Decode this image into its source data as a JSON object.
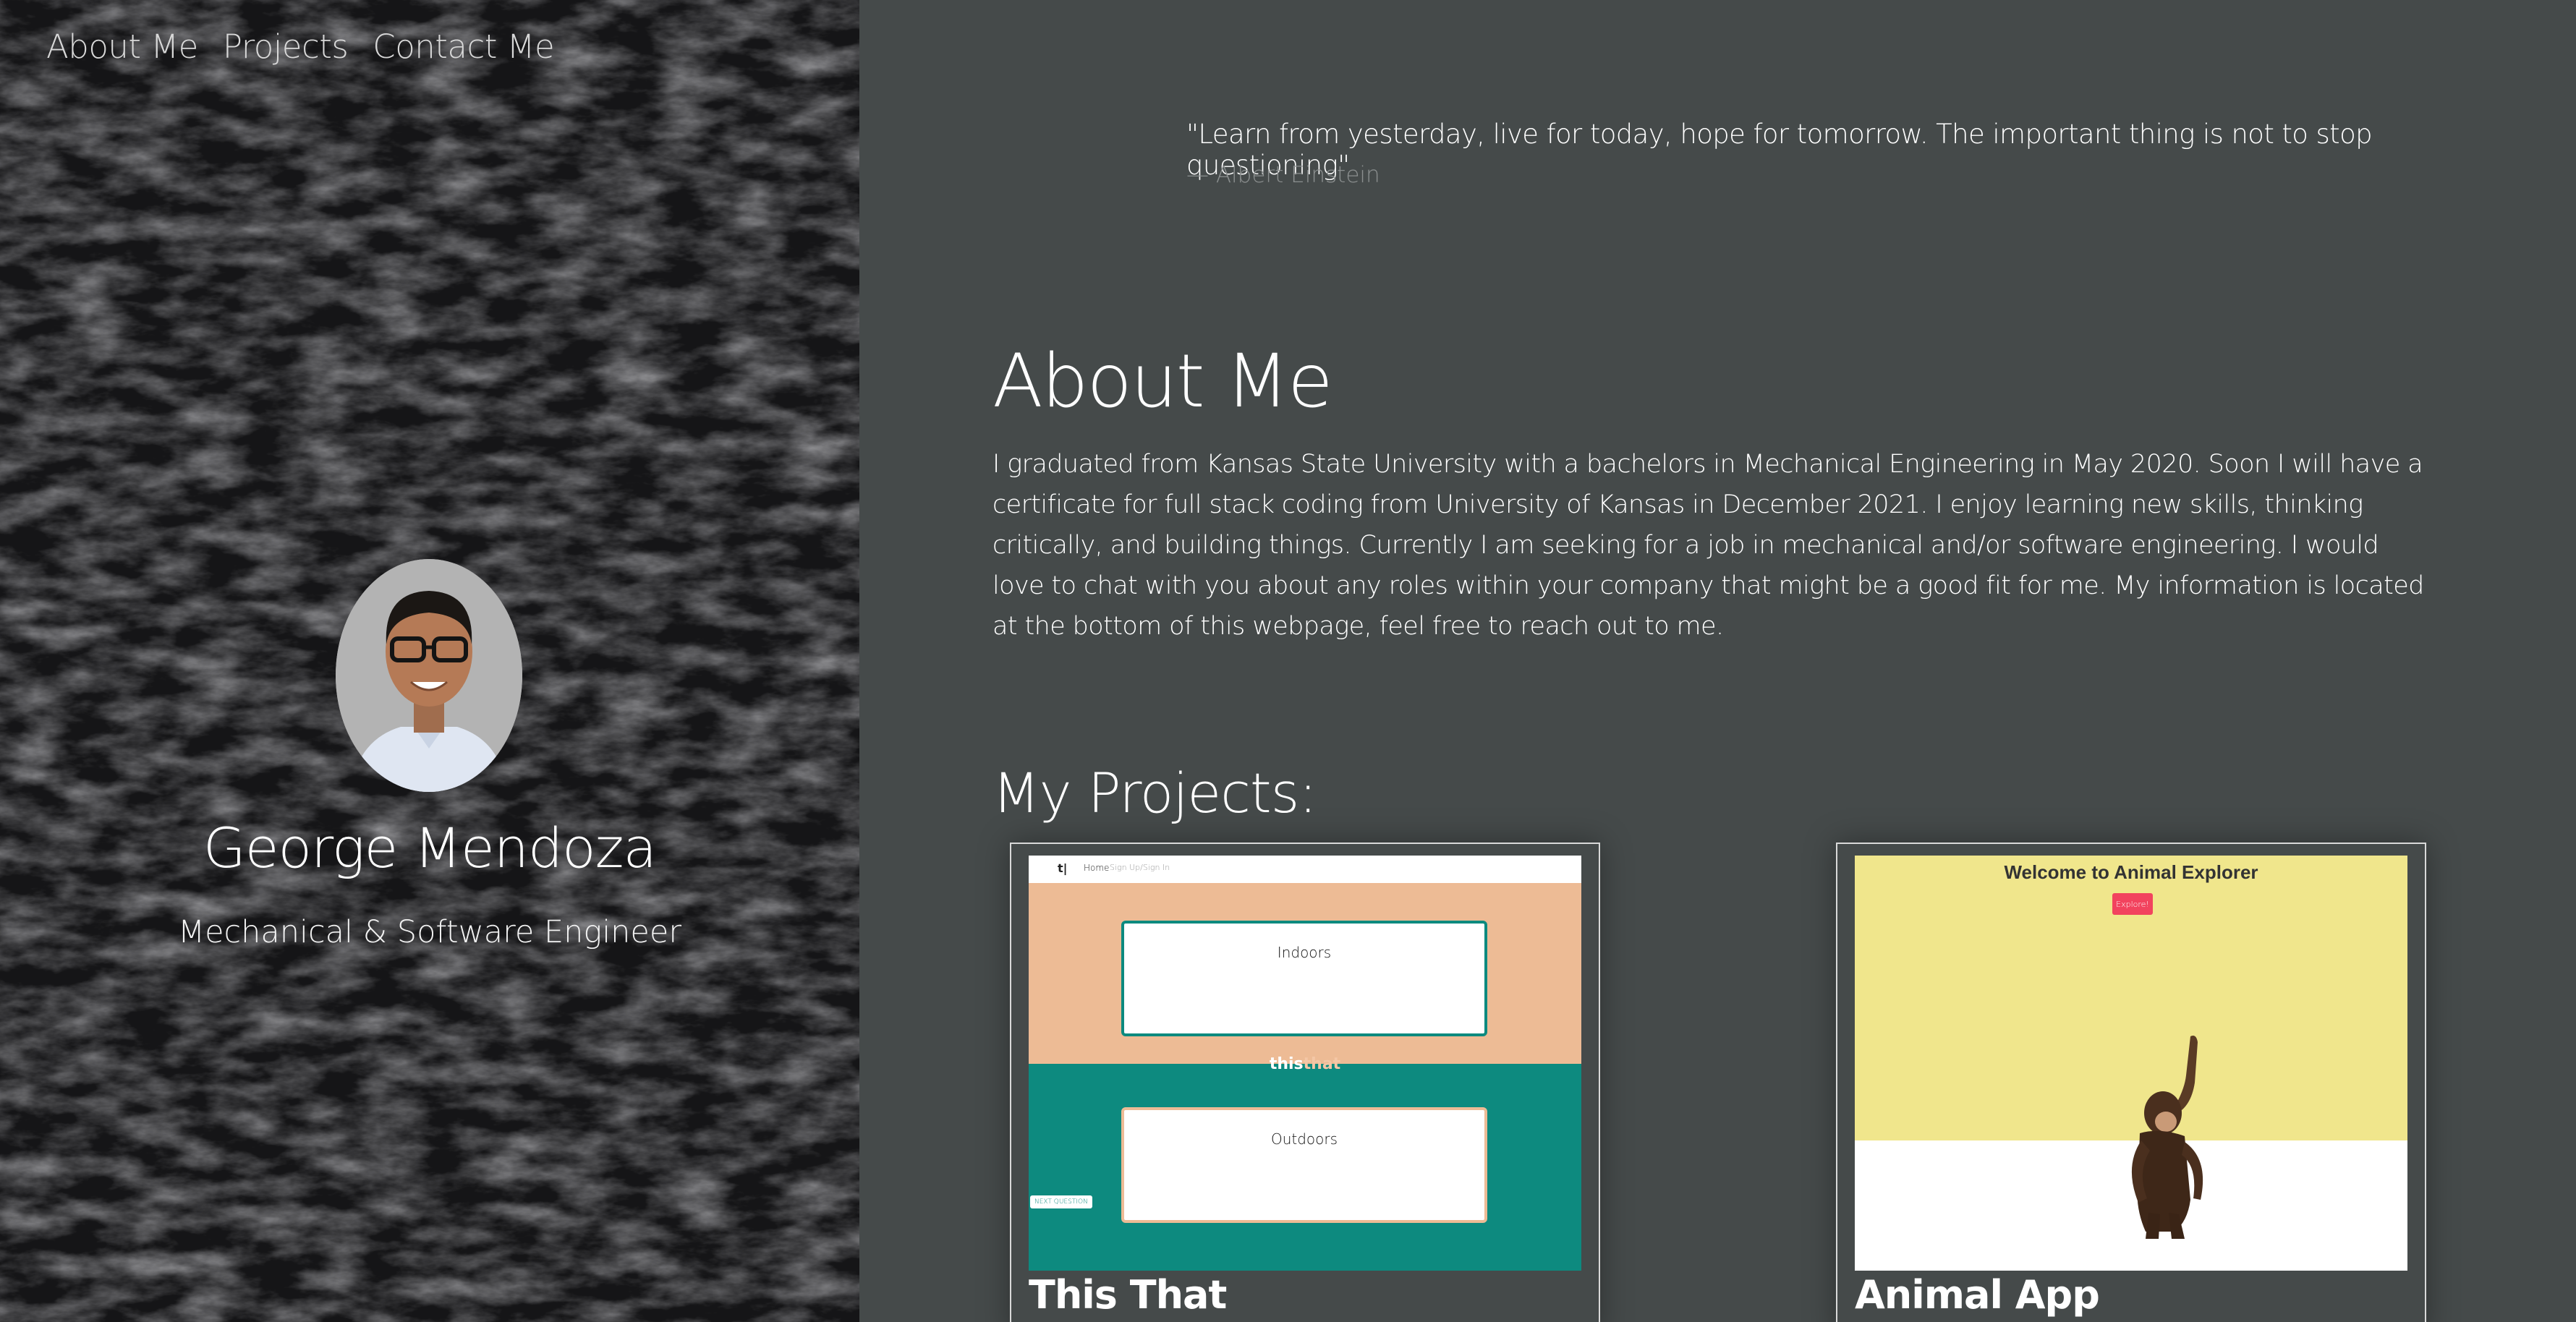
{
  "nav": {
    "items": [
      "About Me",
      "Projects",
      "Contact Me"
    ]
  },
  "profile": {
    "name": "George Mendoza",
    "role": "Mechanical & Software Engineer"
  },
  "quote": {
    "text": "\"Learn from yesterday, live for today, hope for tomorrow. The important thing is not to stop questioning\"",
    "author": "— Albert Einstein"
  },
  "about": {
    "title": "About Me",
    "body": "I graduated from Kansas State University with a bachelors in Mechanical Engineering in May 2020. Soon I will have a certificate for full stack coding from University of Kansas in December 2021. I enjoy learning new skills, thinking critically, and building things. Currently I am seeking for a job in mechanical and/or software engineering. I would love to chat with you about any roles within your company that might be a good fit for me. My information is located at the bottom of this webpage, feel free to reach out to me."
  },
  "projects": {
    "title": "My Projects:",
    "items": [
      {
        "title": "This That",
        "screenshot": {
          "logo": "t|",
          "nav_home": "Home",
          "nav_sign": "Sign Up/Sign In",
          "option_1": "Indoors",
          "option_2": "Outdoors",
          "brand_a": "this",
          "brand_b": "that",
          "next_button": "NEXT QUESTION"
        }
      },
      {
        "title": "Animal App",
        "screenshot": {
          "heading": "Welcome to Animal Explorer",
          "button": "Explore!"
        }
      }
    ]
  },
  "colors": {
    "page_bg": "#454a4a",
    "left_bg": "#1b1b1d",
    "this_that_peach": "#edbb95",
    "this_that_teal": "#0d8a7f",
    "animal_yellow": "#f0e68c",
    "animal_button": "#f2435e"
  },
  "icons": [
    "profile-photo",
    "chimpanzee-illustration"
  ]
}
